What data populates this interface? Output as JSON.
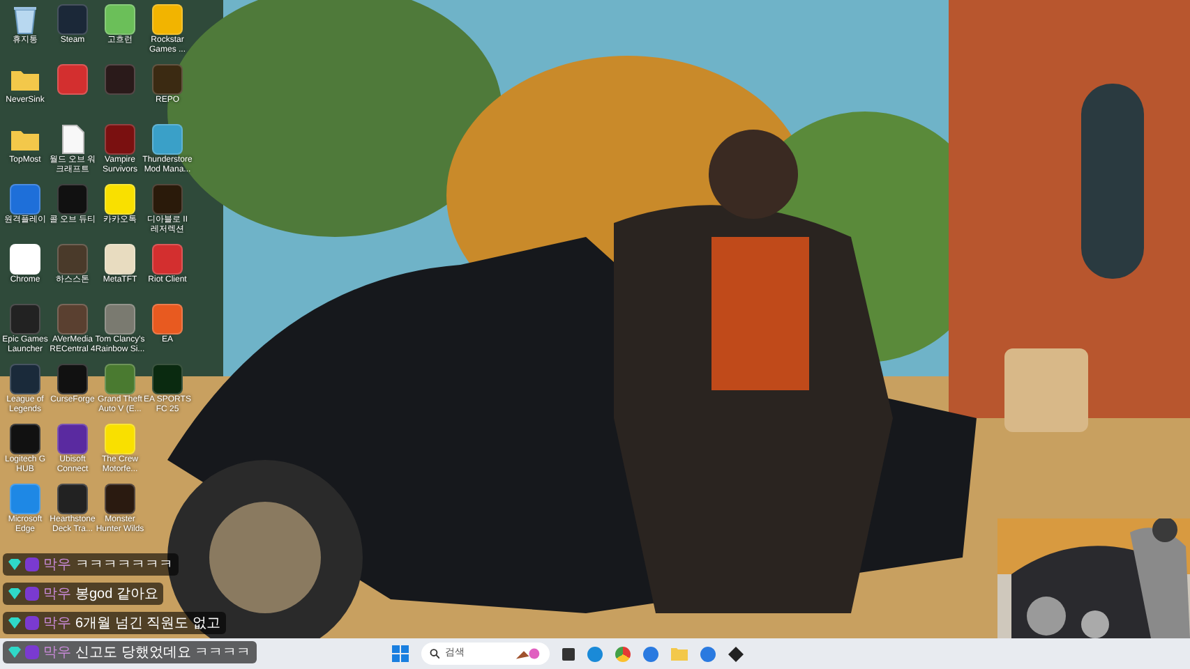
{
  "desktop": {
    "icon_rows": [
      [
        {
          "label": "휴지통",
          "kind": "recycle_bin"
        },
        {
          "label": "Steam",
          "kind": "app"
        },
        {
          "label": "고흐런",
          "kind": "app"
        },
        {
          "label": "Rockstar Games ...",
          "kind": "app"
        }
      ],
      [
        {
          "label": "NeverSink",
          "kind": "folder"
        },
        {
          "kind": "app"
        },
        {
          "kind": "app"
        },
        {
          "label": "REPO",
          "kind": "app"
        }
      ],
      [
        {
          "label": "TopMost",
          "kind": "folder"
        },
        {
          "label": "월드 오브 워크래프트",
          "kind": "document"
        },
        {
          "label": "Vampire Survivors",
          "kind": "app"
        },
        {
          "label": "Thunderstore Mod Mana...",
          "kind": "app"
        }
      ],
      [
        {
          "label": "원격플레이",
          "kind": "app"
        },
        {
          "label": "콜 오브 듀티",
          "kind": "app"
        },
        {
          "label": "카카오톡",
          "kind": "app"
        },
        {
          "label": "디아블로 II 레저렉션",
          "kind": "app"
        }
      ],
      [
        {
          "label": "Chrome",
          "kind": "app"
        },
        {
          "label": "하스스톤",
          "kind": "app"
        },
        {
          "label": "MetaTFT",
          "kind": "app"
        },
        {
          "label": "Riot Client",
          "kind": "app"
        }
      ],
      [
        {
          "label": "Epic Games Launcher",
          "kind": "app"
        },
        {
          "label": "AVerMedia RECentral 4",
          "kind": "app"
        },
        {
          "label": "Tom Clancy's Rainbow Si...",
          "kind": "app"
        },
        {
          "label": "EA",
          "kind": "app"
        }
      ],
      [
        {
          "label": "League of Legends",
          "kind": "app"
        },
        {
          "label": "CurseForge",
          "kind": "app"
        },
        {
          "label": "Grand Theft Auto V (E...",
          "kind": "app"
        },
        {
          "label": "EA SPORTS FC 25",
          "kind": "app"
        }
      ],
      [
        {
          "label": "Logitech G HUB",
          "kind": "app"
        },
        {
          "label": "Ubisoft Connect",
          "kind": "app"
        },
        {
          "label": "The Crew Motorfe...",
          "kind": "app"
        }
      ],
      [
        {
          "label": "Microsoft Edge",
          "kind": "app"
        },
        {
          "label": "Hearthstone Deck Tra...",
          "kind": "app"
        },
        {
          "label": "Monster Hunter Wilds",
          "kind": "app"
        }
      ]
    ]
  },
  "chat": {
    "messages": [
      {
        "user": "막우",
        "text": "ㅋㅋㅋㅋㅋㅋㅋ"
      },
      {
        "user": "막우",
        "text": "봉god 같아요"
      },
      {
        "user": "막우",
        "text": "6개월 넘긴 직원도 없고"
      },
      {
        "user": "막우",
        "text": "신고도 당했었데요 ㅋㅋㅋㅋ"
      }
    ]
  },
  "taskbar": {
    "search": {
      "placeholder": "검색"
    }
  }
}
